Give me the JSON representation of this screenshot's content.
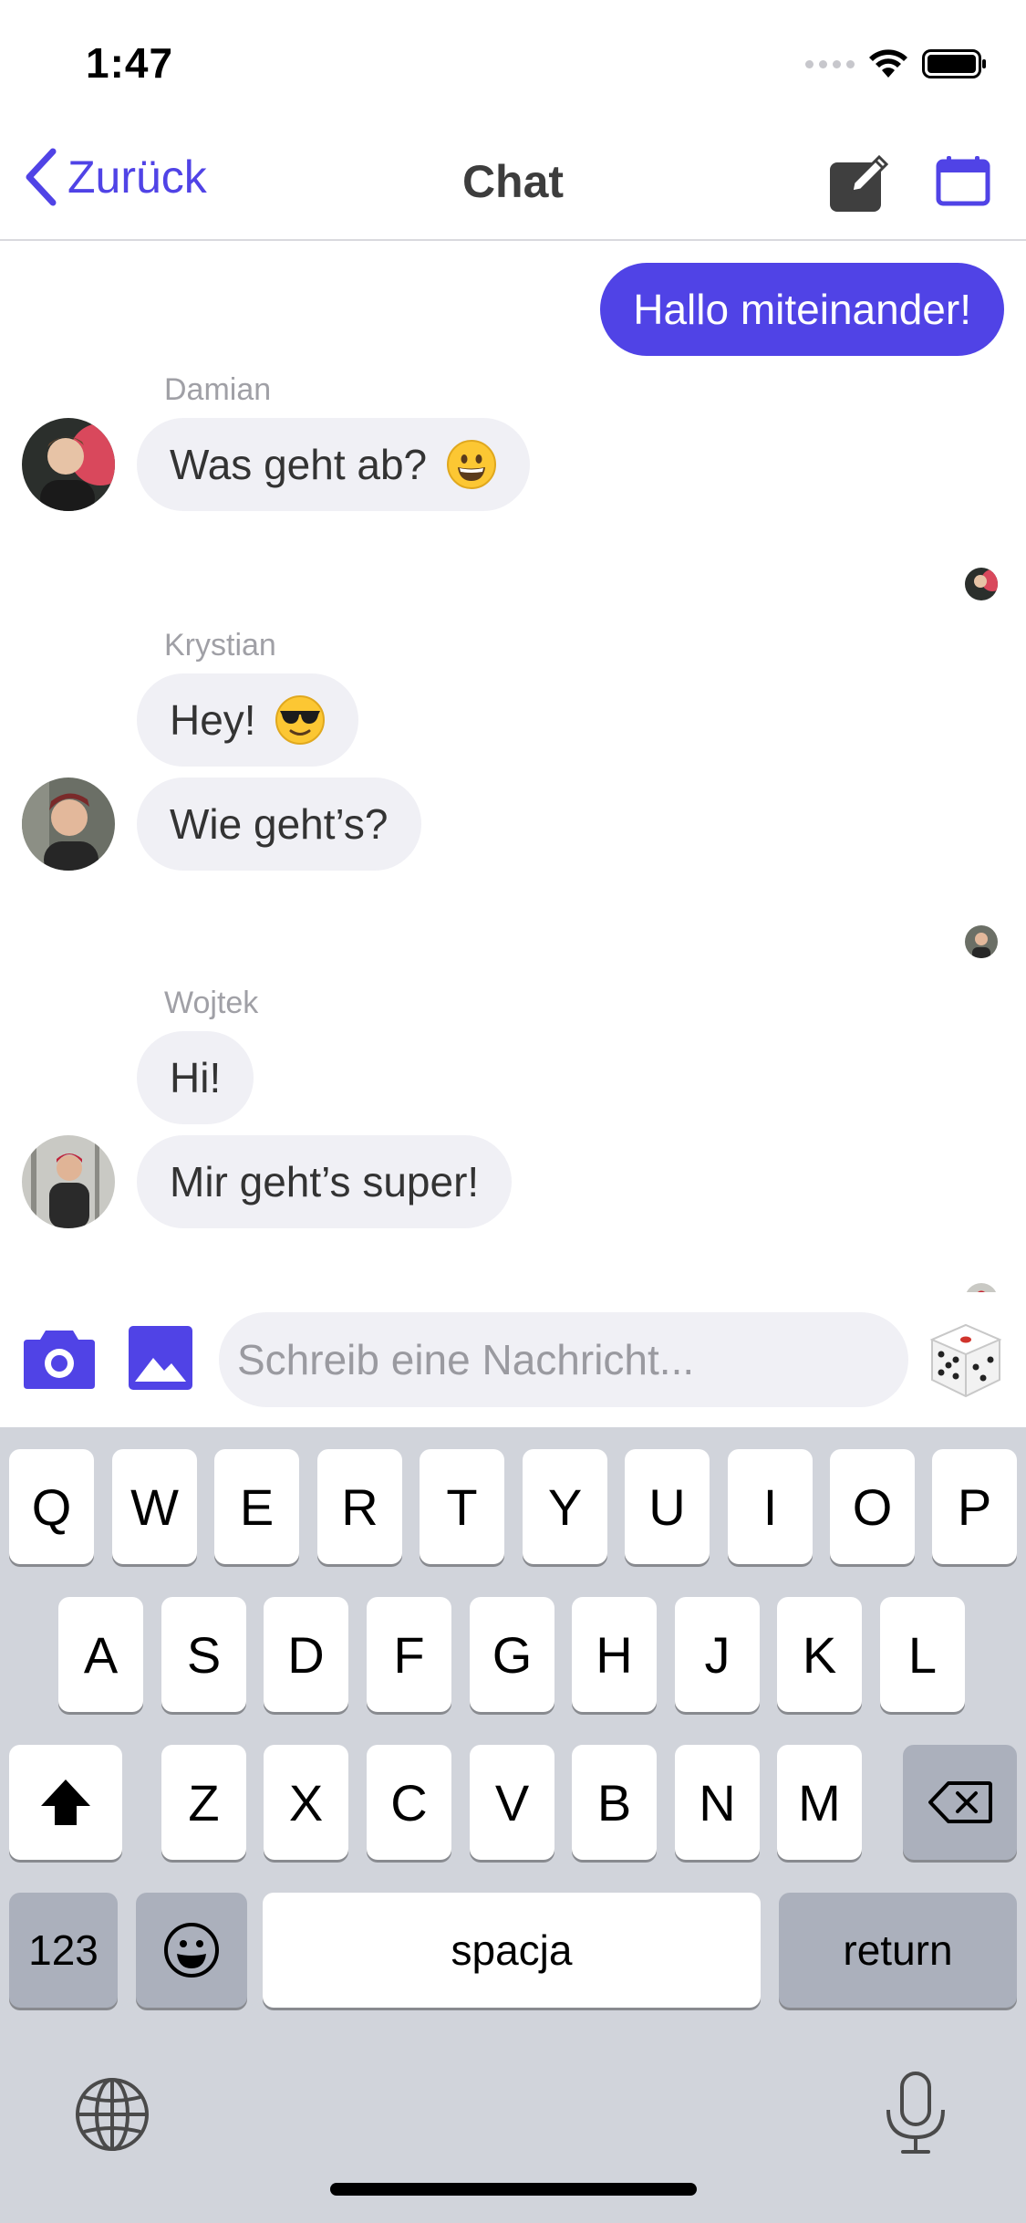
{
  "status_bar": {
    "time": "1:47"
  },
  "nav": {
    "back_label": "Zurück",
    "title": "Chat"
  },
  "colors": {
    "accent": "#5043e6",
    "bubble_in": "#f0f0f5",
    "keyboard_bg": "#d1d4db"
  },
  "messages": [
    {
      "direction": "outgoing",
      "text": "Hallo miteinander!"
    },
    {
      "sender": "Damian",
      "text": "Was geht ab?",
      "emoji": "grinning-face"
    },
    {
      "sender": "Krystian",
      "text": "Hey!",
      "emoji": "smiling-face-with-sunglasses"
    },
    {
      "sender": "Krystian",
      "text": "Wie geht’s?"
    },
    {
      "sender": "Wojtek",
      "text": "Hi!"
    },
    {
      "sender": "Wojtek",
      "text": "Mir geht’s super!"
    }
  ],
  "composer": {
    "placeholder": "Schreib eine Nachricht..."
  },
  "keyboard": {
    "row1": [
      "Q",
      "W",
      "E",
      "R",
      "T",
      "Y",
      "U",
      "I",
      "O",
      "P"
    ],
    "row2": [
      "A",
      "S",
      "D",
      "F",
      "G",
      "H",
      "J",
      "K",
      "L"
    ],
    "row3": [
      "Z",
      "X",
      "C",
      "V",
      "B",
      "N",
      "M"
    ],
    "numbers_label": "123",
    "space_label": "spacja",
    "return_label": "return"
  },
  "icons": [
    "chevron-left-icon",
    "compose-icon",
    "calendar-icon",
    "camera-icon",
    "image-icon",
    "dice-icon",
    "shift-icon",
    "backspace-icon",
    "emoji-icon",
    "globe-icon",
    "microphone-icon",
    "wifi-icon",
    "battery-icon"
  ]
}
